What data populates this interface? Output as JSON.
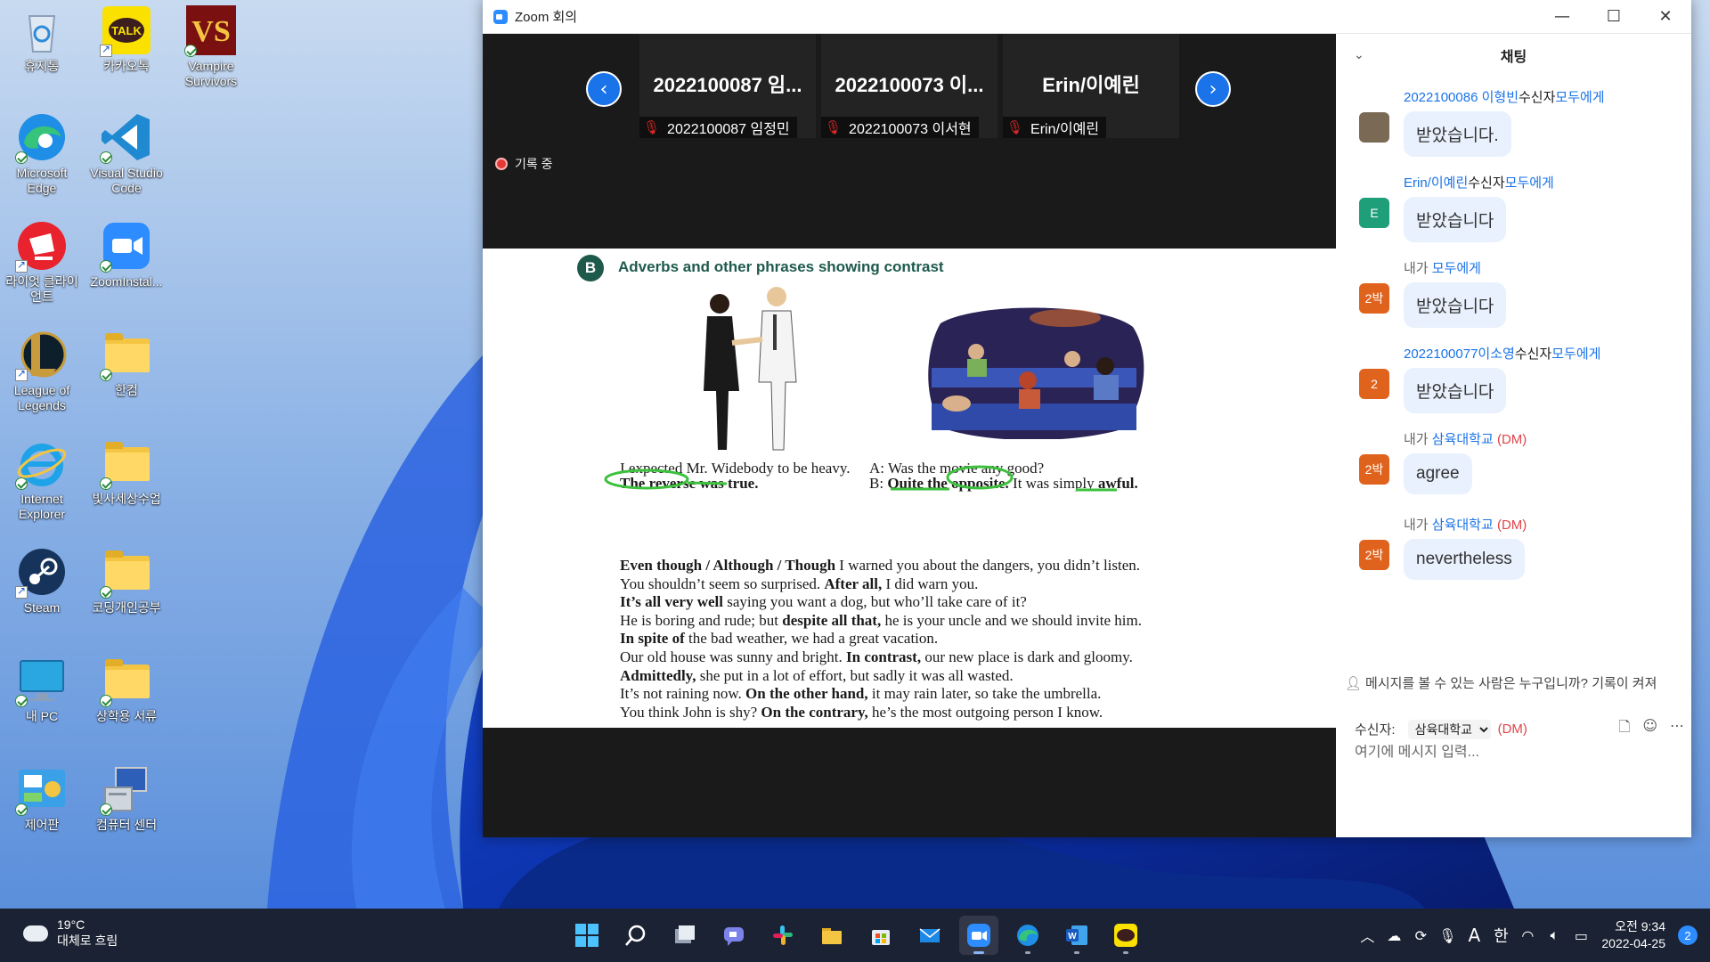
{
  "desktop": {
    "icons": [
      {
        "label": "휴지통"
      },
      {
        "label": "카카오톡"
      },
      {
        "label": "Vampire Survivors"
      },
      {
        "label": "Microsoft Edge"
      },
      {
        "label": "Visual Studio Code"
      },
      {
        "label": "라이엇 클라이언트"
      },
      {
        "label": "ZoomInstal..."
      },
      {
        "label": "League of Legends"
      },
      {
        "label": "한컴"
      },
      {
        "label": "Internet Explorer"
      },
      {
        "label": "빛사세상수업"
      },
      {
        "label": "Steam"
      },
      {
        "label": "코딩개인공부"
      },
      {
        "label": "내 PC"
      },
      {
        "label": "상학용 서류"
      },
      {
        "label": "제어판"
      },
      {
        "label": "컴퓨터 센터"
      }
    ]
  },
  "zoom": {
    "title": "Zoom 회의",
    "window_buttons": {
      "minimize": "—",
      "maximize": "☐",
      "close": "✕"
    },
    "nav": {
      "prev": "‹",
      "next": "›"
    },
    "tiles": [
      {
        "name": "2022100087 임...",
        "footer": "2022100087 임정민"
      },
      {
        "name": "2022100073 이...",
        "footer": "2022100073 이서현"
      },
      {
        "name": "Erin/이예린",
        "footer": "Erin/이예린"
      }
    ],
    "recording": "기록 중",
    "share": {
      "section_letter": "B",
      "heading": "Adverbs and other phrases showing contrast",
      "left_example": [
        "I expected Mr. Widebody to be heavy.",
        "The reverse was true."
      ],
      "right_example": {
        "a": "A:   Was the movie any good?",
        "b_bold": "Quite the opposite.",
        "b_rest": " It was simply ",
        "b_end": "awful.",
        "b_prefix": "B:   "
      },
      "lines": [
        {
          "bold": "Even though / Although / Though",
          "rest": " I warned you about the dangers, you didn’t listen."
        },
        {
          "pre": "You shouldn’t seem so surprised. ",
          "bold": "After all,",
          "rest": " I did warn you."
        },
        {
          "bold": "It’s all very well",
          "rest": " saying you want a dog, but who’ll take care of it?"
        },
        {
          "pre": "He is boring and rude; but ",
          "bold": "despite all that,",
          "rest": " he is your uncle and we should invite him."
        },
        {
          "bold": "In spite of",
          "rest": " the bad weather, we had a great vacation."
        },
        {
          "pre": "Our old house was sunny and bright. ",
          "bold": "In contrast,",
          "rest": " our new place is dark and gloomy."
        },
        {
          "bold": "Admittedly,",
          "rest": " she put in a lot of effort, but sadly it was all wasted."
        },
        {
          "pre": "It’s not raining now. ",
          "bold": "On the other hand,",
          "rest": " it may rain later, so take the umbrella."
        },
        {
          "pre": "You think John is shy? ",
          "bold": "On the contrary,",
          "rest": " he’s the most outgoing person I know."
        }
      ]
    }
  },
  "chat": {
    "title": "채팅",
    "messages": [
      {
        "sender": "2022100086 이형빈",
        "mid": "수신자",
        "target": "모두에게",
        "dm": "",
        "avatar": "",
        "avatar_color": "#7a6a55",
        "text": "받았습니다."
      },
      {
        "sender": "Erin/이예린",
        "mid": "수신자",
        "target": "모두에게",
        "dm": "",
        "avatar": "E",
        "avatar_color": "#1f9e7a",
        "text": "받았습니다"
      },
      {
        "sender": "내가",
        "mid": " ",
        "target": "모두에게",
        "dm": "",
        "avatar": "2박",
        "avatar_color": "#e0631d",
        "text": "받았습니다"
      },
      {
        "sender": "2022100077이소영",
        "mid": "수신자",
        "target": "모두에게",
        "dm": "",
        "avatar": "2",
        "avatar_color": "#e0631d",
        "text": "받았습니다"
      },
      {
        "sender": "내가",
        "mid": " ",
        "target": "삼육대학교",
        "dm": " (DM)",
        "avatar": "2박",
        "avatar_color": "#e0631d",
        "text": "agree"
      },
      {
        "sender": "내가",
        "mid": " ",
        "target": "삼육대학교",
        "dm": " (DM)",
        "avatar": "2박",
        "avatar_color": "#e0631d",
        "text": "nevertheless"
      }
    ],
    "notice": "메시지를 볼 수 있는 사람은 누구입니까? 기록이 켜져",
    "to_label": "수신자:",
    "to_value": "삼육대학교",
    "to_dm": "(DM)",
    "input_placeholder": "여기에 메시지 입력..."
  },
  "taskbar": {
    "weather_temp": "19°C",
    "weather_desc": "대체로 흐림",
    "time": "오전 9:34",
    "date": "2022-04-25",
    "ime_a": "A",
    "ime_han": "한",
    "notifications": "2"
  }
}
